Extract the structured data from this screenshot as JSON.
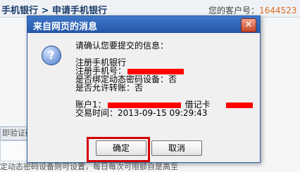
{
  "background": {
    "title": "手机银行 > 申请手机银行",
    "customer_label": "您的客户号：",
    "customer_number": "1644523",
    "left_button": "即验证码",
    "footer_text": "定动态密码设备则可设置，每日每次可限额自是高至"
  },
  "dialog": {
    "title": "来自网页的消息",
    "close_label": "✕",
    "icon": "question-icon",
    "lines": [
      "请确认您要提交的信息：",
      "注册手机银行",
      "注册手机号：",
      "是否绑定动态密码设备：否",
      "是否允许转账：否",
      "账户1：",
      "借记卡",
      "交易时间：2013-09-15 09:29:43"
    ],
    "ok_label": "确定",
    "cancel_label": "取消"
  },
  "colors": {
    "titlebar": "#2b5ba7",
    "redaction": "#ff0000",
    "highlight": "#d40000"
  }
}
